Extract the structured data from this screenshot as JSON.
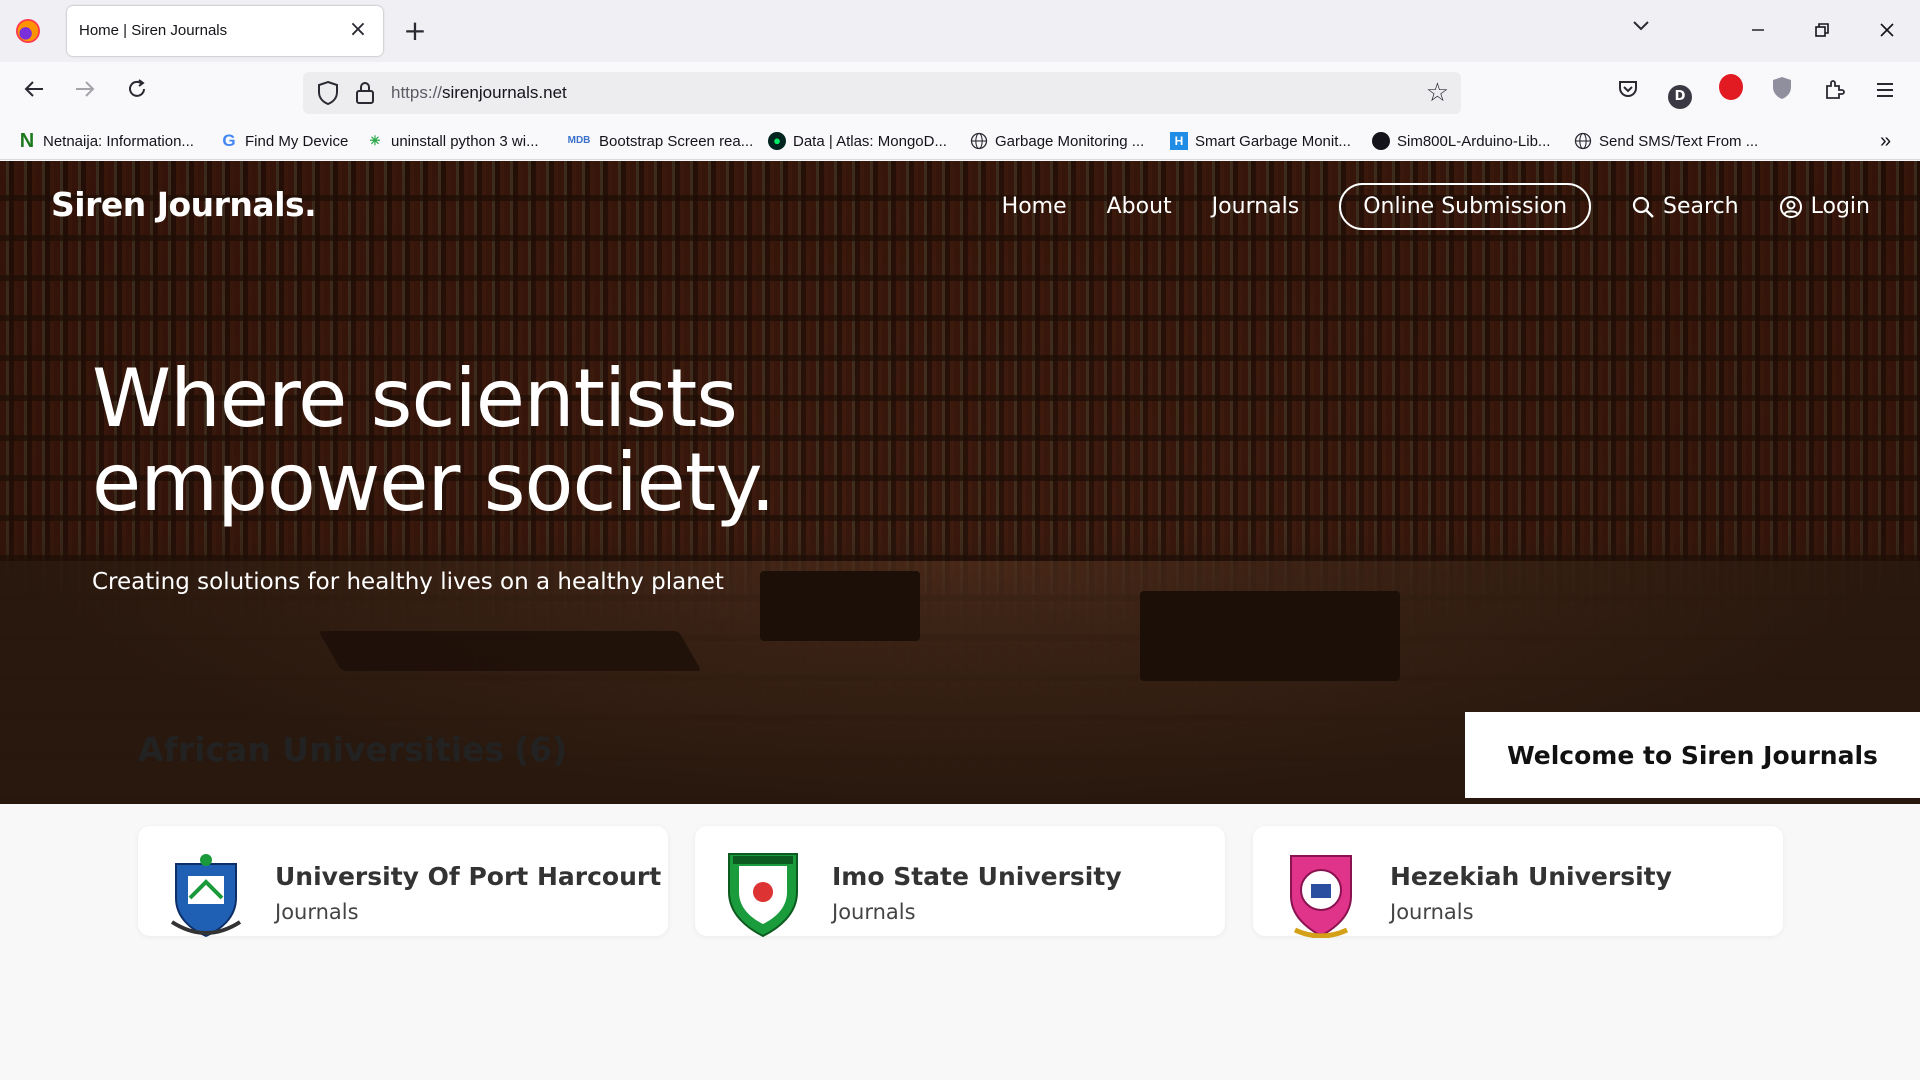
{
  "browser": {
    "tab_title": "Home | Siren Journals",
    "url_scheme": "https://",
    "url_host": "sirenjournals.net",
    "bookmarks": [
      {
        "label": "Netnaija: Information...",
        "icon": "netnaija-icon"
      },
      {
        "label": "Find My Device",
        "icon": "google-icon"
      },
      {
        "label": "uninstall python 3 wi...",
        "icon": "python-spark-icon"
      },
      {
        "label": "Bootstrap Screen rea...",
        "icon": "mdb-icon"
      },
      {
        "label": "Data | Atlas: MongoD...",
        "icon": "mongodb-leaf-icon"
      },
      {
        "label": "Garbage Monitoring ...",
        "icon": "globe-icon"
      },
      {
        "label": "Smart Garbage Monit...",
        "icon": "hackster-icon"
      },
      {
        "label": "Sim800L-Arduino-Lib...",
        "icon": "github-icon"
      },
      {
        "label": "Send SMS/Text From ...",
        "icon": "globe-icon"
      }
    ],
    "profile_initial": "D"
  },
  "site": {
    "logo": "Siren Journals.",
    "nav": {
      "home": "Home",
      "about": "About",
      "journals": "Journals",
      "submission": "Online Submission",
      "search": "Search",
      "login": "Login"
    },
    "hero": {
      "headline_line1": "Where scientists",
      "headline_line2": "empower society.",
      "subline": "Creating solutions for healthy lives on a healthy planet",
      "welcome": "Welcome to Siren Journals"
    },
    "section": {
      "title": "African Universities",
      "count": "(6)"
    },
    "universities": [
      {
        "name": "University Of Port Harcourt",
        "sub": "Journals"
      },
      {
        "name": "Imo State University",
        "sub": "Journals"
      },
      {
        "name": "Hezekiah University",
        "sub": "Journals"
      }
    ]
  }
}
